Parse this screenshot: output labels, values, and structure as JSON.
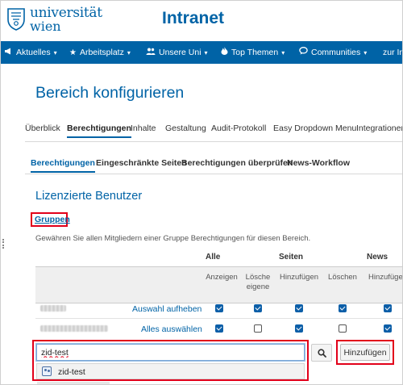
{
  "header": {
    "logo_line1": "universität",
    "logo_line2": "wien",
    "title": "Intranet"
  },
  "nav": [
    {
      "label": "Aktuelles",
      "icon": "megaphone-icon"
    },
    {
      "label": "Arbeitsplatz",
      "icon": "star-icon"
    },
    {
      "label": "Unsere Uni",
      "icon": "people-icon"
    },
    {
      "label": "Top Themen",
      "icon": "fire-icon"
    },
    {
      "label": "Communities",
      "icon": "comment-icon"
    },
    {
      "label": "zur Int",
      "icon": ""
    }
  ],
  "page_title": "Bereich konfigurieren",
  "tabs": [
    "Überblick",
    "Berechtigungen",
    "Inhalte",
    "Gestaltung",
    "Audit-Protokoll",
    "Easy Dropdown Menu",
    "Integrationen"
  ],
  "active_tab": "Berechtigungen",
  "subtabs": [
    "Berechtigungen",
    "Eingeschränkte Seiten",
    "Berechtigungen überprüfen",
    "News-Workflow"
  ],
  "active_subtab": "Berechtigungen",
  "section_title": "Lizenzierte Benutzer",
  "groups_heading": "Gruppen",
  "description": "Gewähren Sie allen Mitgliedern einer Gruppe Berechtigungen für diesen Bereich.",
  "table": {
    "groups": [
      "Alle",
      "Seiten",
      "News"
    ],
    "subheaders": [
      "Anzeigen",
      "Lösche eigene",
      "Hinzufügen",
      "Löschen",
      "Hinzufügen"
    ],
    "rows": [
      {
        "link": "Auswahl aufheben",
        "checks": [
          true,
          true,
          true,
          true,
          true
        ]
      },
      {
        "link": "Alles auswählen",
        "checks": [
          true,
          false,
          true,
          false,
          true
        ]
      }
    ]
  },
  "search": {
    "value": "zid-test",
    "suggestion": "zid-test",
    "button_icon": "search-icon"
  },
  "add_button": "Hinzufügen",
  "colors": {
    "brand": "#0063a6",
    "highlight": "#e2001a"
  }
}
